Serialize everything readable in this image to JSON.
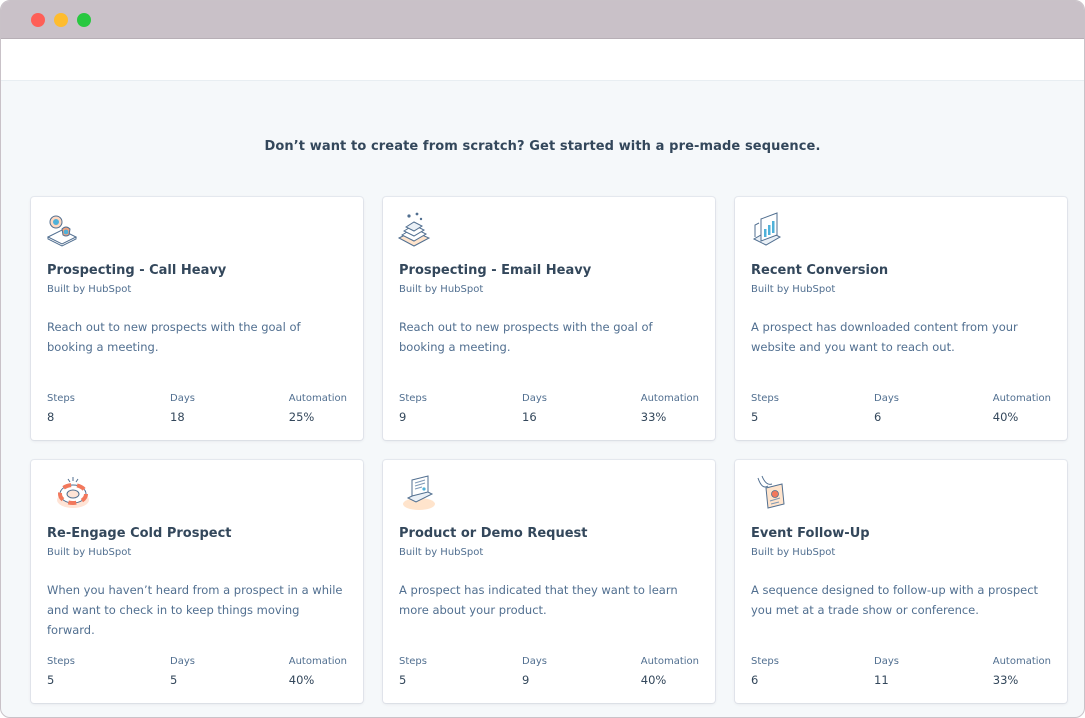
{
  "heading": "Don’t want to create from scratch? Get started with a pre-made sequence.",
  "stat_labels": {
    "steps": "Steps",
    "days": "Days",
    "automation": "Automation"
  },
  "cards": [
    {
      "title": "Prospecting - Call Heavy",
      "byline": "Built by HubSpot",
      "description": "Reach out to new prospects with the goal of booking a meeting.",
      "steps": "8",
      "days": "18",
      "automation": "25%",
      "icon": "phone-call-icon"
    },
    {
      "title": "Prospecting - Email Heavy",
      "byline": "Built by HubSpot",
      "description": "Reach out to new prospects with the goal of booking a meeting.",
      "steps": "9",
      "days": "16",
      "automation": "33%",
      "icon": "email-stack-icon"
    },
    {
      "title": "Recent Conversion",
      "byline": "Built by HubSpot",
      "description": "A prospect has downloaded content from your website and you want to reach out.",
      "steps": "5",
      "days": "6",
      "automation": "40%",
      "icon": "document-chart-icon"
    },
    {
      "title": "Re-Engage Cold Prospect",
      "byline": "Built by HubSpot",
      "description": "When you haven’t heard from a prospect in a while and want to check in to keep things moving forward.",
      "steps": "5",
      "days": "5",
      "automation": "40%",
      "icon": "life-ring-icon"
    },
    {
      "title": "Product or Demo Request",
      "byline": "Built by HubSpot",
      "description": "A prospect has indicated that they want to learn more about your product.",
      "steps": "5",
      "days": "9",
      "automation": "40%",
      "icon": "demo-screen-icon"
    },
    {
      "title": "Event Follow-Up",
      "byline": "Built by HubSpot",
      "description": "A sequence designed to follow-up with a prospect you met at a trade show or conference.",
      "steps": "6",
      "days": "11",
      "automation": "33%",
      "icon": "event-badge-icon"
    }
  ]
}
